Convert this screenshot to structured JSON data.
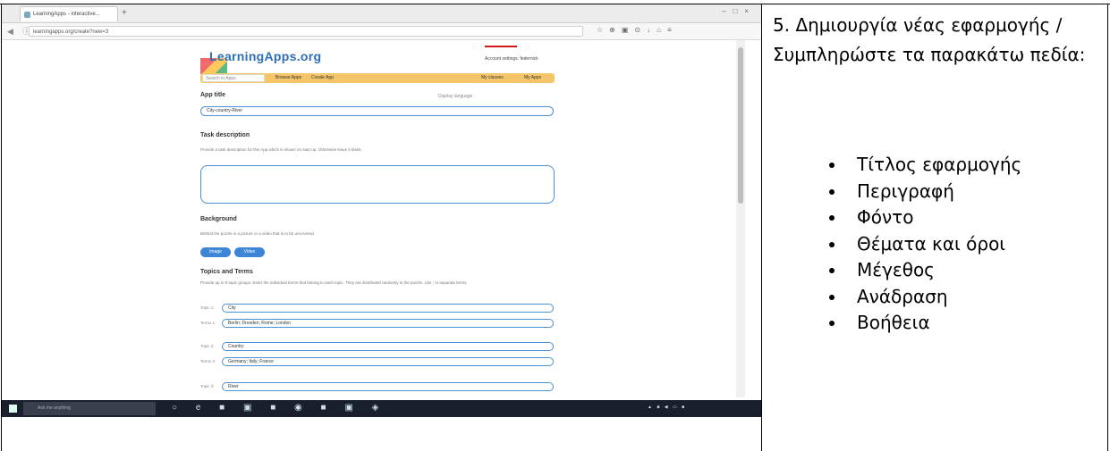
{
  "screenshot": {
    "tab_title": "LearningApps - interactive...",
    "url": "learningapps.org/create?new=3",
    "logo": "LearningApps.org",
    "account": "Account settings: federnick",
    "search_placeholder": "Search in Apps",
    "menu": {
      "browse": "Browse Apps",
      "create": "Create App",
      "classes": "My classes",
      "my_apps": "My Apps"
    },
    "display_language": "Display language",
    "app_title_label": "App title",
    "app_title_value": "City-country-River",
    "task_description_label": "Task description",
    "task_description_hint": "Provide a task description for this App which is shown on start up. Otherwise leave it blank.",
    "background_label": "Background",
    "background_hint": "Behind the puzzle is a picture or a video that is to be uncovered.",
    "image_button": "Image",
    "video_button": "Video",
    "topics_label": "Topics and Terms",
    "topics_hint": "Provide up to 8 topic groups. Enter the individual terms that belong to each topic. They are distributed randomly in the puzzle. Use ; to separate terms.",
    "rows": [
      {
        "label": "Topic 1:",
        "value": "City"
      },
      {
        "label": "Terms 1:",
        "value": "Berlin; Dresden; Rome; London"
      },
      {
        "label": "Topic 2:",
        "value": "Country"
      },
      {
        "label": "Terms 2:",
        "value": "Germany; Italy; France"
      },
      {
        "label": "Topic 3:",
        "value": "River"
      }
    ],
    "cortana": "Ask me anything"
  },
  "instructions": {
    "title": "5. Δημιουργία νέας εφαρμογής / Συμπληρώστε τα παρακάτω πεδία:",
    "items": [
      "Τίτλος εφαρμογής",
      "Περιγραφή",
      "Φόντο",
      "Θέματα και όροι",
      "Μέγεθος",
      "Ανάδραση",
      "Βοήθεια"
    ]
  }
}
